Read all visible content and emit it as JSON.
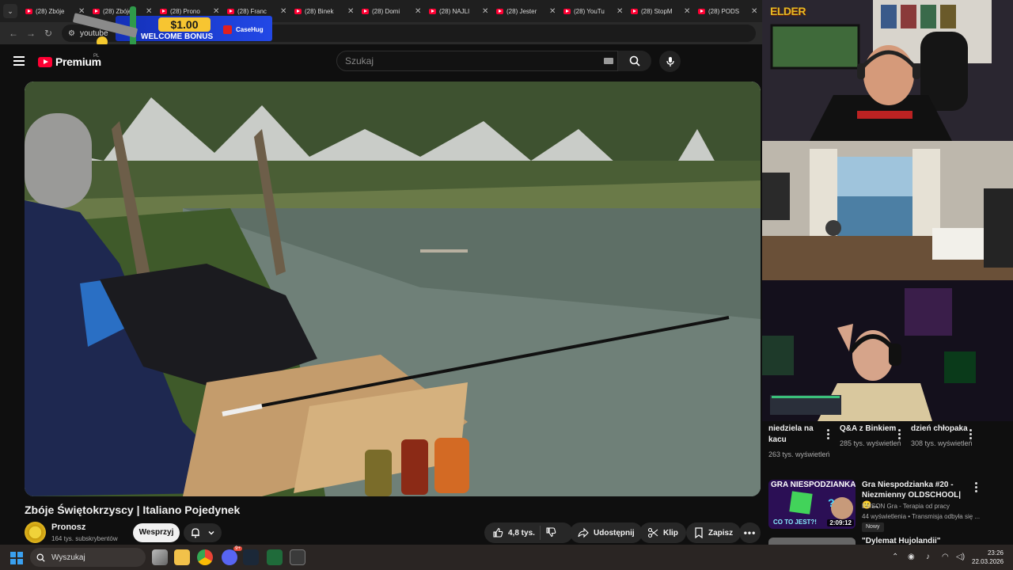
{
  "browser": {
    "tabs": [
      {
        "label": "(28) Zbóje"
      },
      {
        "label": "(28) Zbóje"
      },
      {
        "label": "(28) Prono"
      },
      {
        "label": "(28) Franc"
      },
      {
        "label": "(28) Binek"
      },
      {
        "label": "(28) Domi"
      },
      {
        "label": "(28) NAJLI"
      },
      {
        "label": "(28) Jester"
      },
      {
        "label": "(28) YouTu"
      },
      {
        "label": "(28) StopM"
      },
      {
        "label": "(28) PODS"
      }
    ],
    "tab_close": "✕",
    "url": "youtube"
  },
  "ad": {
    "amount": "$1.00",
    "bonus": "WELCOME BONUS",
    "brand": "CaseHug"
  },
  "youtube": {
    "logo_text": "Premium",
    "logo_country": "PL",
    "search_placeholder": "Szukaj"
  },
  "video": {
    "title": "Zbóje Świętokrzyscy | Italiano Pojedynek",
    "channel": "Pronosz",
    "subscribers": "164 tys. subskrybentów",
    "support_label": "Wesprzyj",
    "like_count": "4,8 tys.",
    "share_label": "Udostępnij",
    "clip_label": "Klip",
    "save_label": "Zapisz"
  },
  "stream_overlay": {
    "streamer_logo": "ELDER"
  },
  "shorts": [
    {
      "title": "niedziela na kacu",
      "views": "263 tys. wyświetleń"
    },
    {
      "title": "Q&A z Binkiem",
      "views": "285 tys. wyświetleń"
    },
    {
      "title": "dzień chłopaka",
      "views": "308 tys. wyświetleń"
    }
  ],
  "recommended": [
    {
      "thumb_text": "GRA NIESPODZIANKA",
      "thumb_sub": "CO TO JEST?!",
      "duration": "2:09:12",
      "title": "Gra Niespodzianka #20 - Niezmienny OLDSCHOOL|🙂...",
      "channel": "EMSON Gra - Terapia od pracy",
      "meta": "44 wyświetlenia • Transmisja odbyła się ...",
      "badge": "Nowy"
    },
    {
      "title": "\"Dylemat Hujolandii\""
    }
  ],
  "taskbar": {
    "search_label": "Wyszukaj",
    "discord_badge": "9+",
    "time": "23:26",
    "date": "22.03.2026"
  }
}
